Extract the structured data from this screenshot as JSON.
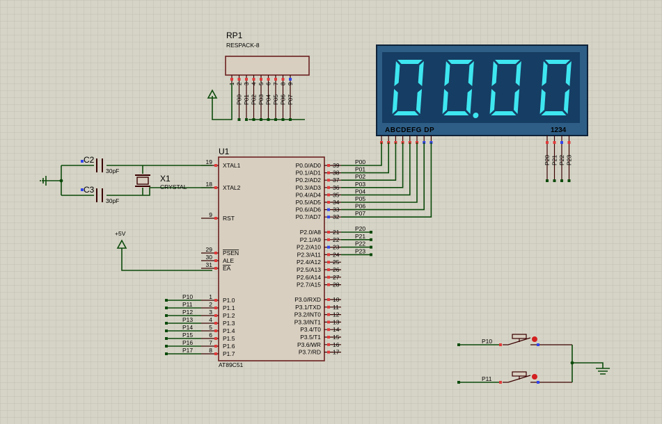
{
  "rp1": {
    "ref": "RP1",
    "value": "RESPACK-8",
    "pin_numbers": [
      "1",
      "2",
      "3",
      "4",
      "5",
      "6",
      "7",
      "8",
      "9"
    ],
    "nets": [
      "P00",
      "P01",
      "P02",
      "P03",
      "P04",
      "P05",
      "P06",
      "P07"
    ]
  },
  "display": {
    "digits": [
      "0",
      "0",
      "0",
      "0"
    ],
    "decimal_after": 2,
    "segment_label": "ABCDEFG  DP",
    "digit_label": "1234",
    "digit_nets": [
      "P20",
      "P21",
      "P22",
      "P23"
    ],
    "bg": "#163d63",
    "seg_on": "#3ee6f0"
  },
  "u1": {
    "ref": "U1",
    "part": "AT89C51",
    "left_pins": [
      {
        "num": "19",
        "name": "XTAL1"
      },
      {
        "num": "18",
        "name": "XTAL2"
      },
      {
        "num": "9",
        "name": "RST"
      },
      {
        "num": "29",
        "name": "PSEN"
      },
      {
        "num": "30",
        "name": "ALE"
      },
      {
        "num": "31",
        "name": "EA"
      },
      {
        "num": "1",
        "name": "P1.0"
      },
      {
        "num": "2",
        "name": "P1.1"
      },
      {
        "num": "3",
        "name": "P1.2"
      },
      {
        "num": "4",
        "name": "P1.3"
      },
      {
        "num": "5",
        "name": "P1.4"
      },
      {
        "num": "6",
        "name": "P1.5"
      },
      {
        "num": "7",
        "name": "P1.6"
      },
      {
        "num": "8",
        "name": "P1.7"
      }
    ],
    "p0_pins": [
      {
        "num": "39",
        "name": "P0.0/AD0",
        "net": "P00"
      },
      {
        "num": "38",
        "name": "P0.1/AD1",
        "net": "P01"
      },
      {
        "num": "37",
        "name": "P0.2/AD2",
        "net": "P02"
      },
      {
        "num": "36",
        "name": "P0.3/AD3",
        "net": "P03"
      },
      {
        "num": "35",
        "name": "P0.4/AD4",
        "net": "P04"
      },
      {
        "num": "34",
        "name": "P0.5/AD5",
        "net": "P05"
      },
      {
        "num": "33",
        "name": "P0.6/AD6",
        "net": "P06"
      },
      {
        "num": "32",
        "name": "P0.7/AD7",
        "net": "P07"
      }
    ],
    "p2_pins": [
      {
        "num": "21",
        "name": "P2.0/A8",
        "net": "P20"
      },
      {
        "num": "22",
        "name": "P2.1/A9",
        "net": "P21"
      },
      {
        "num": "23",
        "name": "P2.2/A10",
        "net": "P22"
      },
      {
        "num": "24",
        "name": "P2.3/A11",
        "net": "P23"
      },
      {
        "num": "25",
        "name": "P2.4/A12",
        "net": ""
      },
      {
        "num": "26",
        "name": "P2.5/A13",
        "net": ""
      },
      {
        "num": "27",
        "name": "P2.6/A14",
        "net": ""
      },
      {
        "num": "28",
        "name": "P2.7/A15",
        "net": ""
      }
    ],
    "p3_pins": [
      {
        "num": "10",
        "name": "P3.0/RXD"
      },
      {
        "num": "11",
        "name": "P3.1/TXD"
      },
      {
        "num": "12",
        "name": "P3.2/INT0"
      },
      {
        "num": "13",
        "name": "P3.3/INT1"
      },
      {
        "num": "14",
        "name": "P3.4/T0"
      },
      {
        "num": "15",
        "name": "P3.5/T1"
      },
      {
        "num": "16",
        "name": "P3.6/WR"
      },
      {
        "num": "17",
        "name": "P3.7/RD"
      }
    ],
    "p1_nets": [
      "P10",
      "P11",
      "P12",
      "P13",
      "P14",
      "P15",
      "P16",
      "P17"
    ]
  },
  "c2": {
    "ref": "C2",
    "value": "30pF"
  },
  "c3": {
    "ref": "C3",
    "value": "30pF"
  },
  "x1": {
    "ref": "X1",
    "value": "CRYSTAL"
  },
  "power": {
    "label": "+5V"
  },
  "buttons": [
    {
      "net": "P10"
    },
    {
      "net": "P11"
    }
  ]
}
